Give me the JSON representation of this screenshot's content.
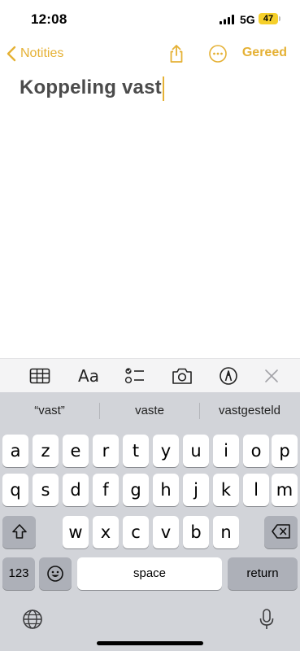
{
  "status": {
    "time": "12:08",
    "network": "5G",
    "battery": "47",
    "battery_color": "#f5cf2a"
  },
  "nav": {
    "back_label": "Notities",
    "done_label": "Gereed",
    "accent": "#e5b135",
    "icons": [
      "chevron-left-icon",
      "share-icon",
      "more-icon"
    ]
  },
  "note": {
    "title": "Koppeling vast"
  },
  "format_toolbar": {
    "aa_label": "Aa",
    "icons": [
      "table-icon",
      "text-format-icon",
      "checklist-icon",
      "camera-icon",
      "markup-icon",
      "close-icon"
    ]
  },
  "keyboard": {
    "suggestions": [
      "“vast”",
      "vaste",
      "vastgesteld"
    ],
    "row1": [
      "a",
      "z",
      "e",
      "r",
      "t",
      "y",
      "u",
      "i",
      "o",
      "p"
    ],
    "row2": [
      "q",
      "s",
      "d",
      "f",
      "g",
      "h",
      "j",
      "k",
      "l",
      "m"
    ],
    "row3": [
      "w",
      "x",
      "c",
      "v",
      "b",
      "n"
    ],
    "numbers_label": "123",
    "space_label": "space",
    "return_label": "return",
    "icons": [
      "shift-icon",
      "delete-icon",
      "emoji-icon",
      "globe-icon",
      "microphone-icon"
    ]
  }
}
